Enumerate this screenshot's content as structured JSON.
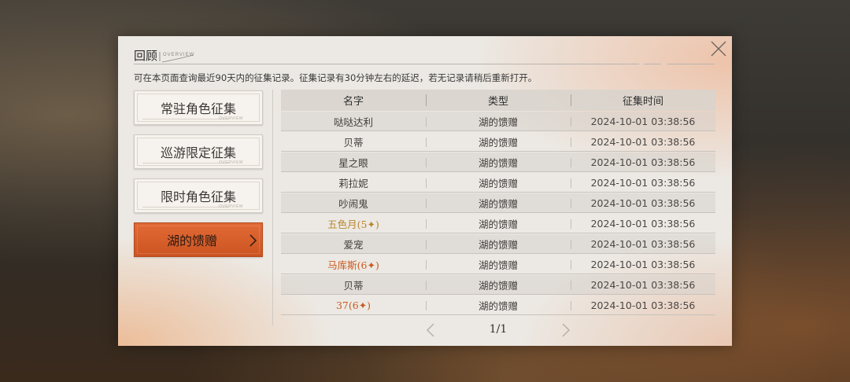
{
  "header": {
    "title": "回顾",
    "subtitle": "OVERVIEW",
    "close_icon": "close-icon"
  },
  "notice": "可在本页面查询最近90天内的征集记录。征集记录有30分钟左右的延迟，若无记录请稍后重新打开。",
  "categories": [
    {
      "label": "常驻角色征集",
      "tag": "OVERVIEW",
      "active": false
    },
    {
      "label": "巡游限定征集",
      "tag": "OVERVIEW",
      "active": false
    },
    {
      "label": "限时角色征集",
      "tag": "OVERVIEW",
      "active": false
    },
    {
      "label": "湖的馈赠",
      "tag": "",
      "active": true
    }
  ],
  "table": {
    "headers": [
      "名字",
      "类型",
      "征集时间"
    ],
    "rows": [
      {
        "name": "哒哒达利",
        "type": "湖的馈赠",
        "time": "2024-10-01 03:38:56",
        "rarity": "normal"
      },
      {
        "name": "贝蒂",
        "type": "湖的馈赠",
        "time": "2024-10-01 03:38:56",
        "rarity": "normal"
      },
      {
        "name": "星之眼",
        "type": "湖的馈赠",
        "time": "2024-10-01 03:38:56",
        "rarity": "normal"
      },
      {
        "name": "莉拉妮",
        "type": "湖的馈赠",
        "time": "2024-10-01 03:38:56",
        "rarity": "normal"
      },
      {
        "name": "吵闹鬼",
        "type": "湖的馈赠",
        "time": "2024-10-01 03:38:56",
        "rarity": "normal"
      },
      {
        "name": "五色月(5✦)",
        "type": "湖的馈赠",
        "time": "2024-10-01 03:38:56",
        "rarity": "five"
      },
      {
        "name": "爱宠",
        "type": "湖的馈赠",
        "time": "2024-10-01 03:38:56",
        "rarity": "normal"
      },
      {
        "name": "马库斯(6✦)",
        "type": "湖的馈赠",
        "time": "2024-10-01 03:38:56",
        "rarity": "six"
      },
      {
        "name": "贝蒂",
        "type": "湖的馈赠",
        "time": "2024-10-01 03:38:56",
        "rarity": "normal"
      },
      {
        "name": "37(6✦)",
        "type": "湖的馈赠",
        "time": "2024-10-01 03:38:56",
        "rarity": "six"
      }
    ]
  },
  "pagination": {
    "text": "1/1",
    "prev_icon": "chevron-left-icon",
    "next_icon": "chevron-right-icon"
  },
  "colors": {
    "active_tab": "#d95e2b",
    "five_star": "#b8862e",
    "six_star": "#cc5a20"
  }
}
